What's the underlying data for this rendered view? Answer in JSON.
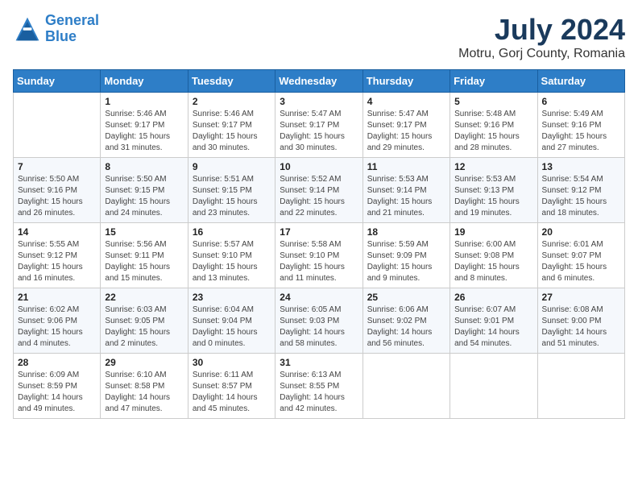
{
  "header": {
    "logo": {
      "line1": "General",
      "line2": "Blue"
    },
    "month_year": "July 2024",
    "location": "Motru, Gorj County, Romania"
  },
  "days_of_week": [
    "Sunday",
    "Monday",
    "Tuesday",
    "Wednesday",
    "Thursday",
    "Friday",
    "Saturday"
  ],
  "weeks": [
    [
      {
        "day": "",
        "info": ""
      },
      {
        "day": "1",
        "info": "Sunrise: 5:46 AM\nSunset: 9:17 PM\nDaylight: 15 hours\nand 31 minutes."
      },
      {
        "day": "2",
        "info": "Sunrise: 5:46 AM\nSunset: 9:17 PM\nDaylight: 15 hours\nand 30 minutes."
      },
      {
        "day": "3",
        "info": "Sunrise: 5:47 AM\nSunset: 9:17 PM\nDaylight: 15 hours\nand 30 minutes."
      },
      {
        "day": "4",
        "info": "Sunrise: 5:47 AM\nSunset: 9:17 PM\nDaylight: 15 hours\nand 29 minutes."
      },
      {
        "day": "5",
        "info": "Sunrise: 5:48 AM\nSunset: 9:16 PM\nDaylight: 15 hours\nand 28 minutes."
      },
      {
        "day": "6",
        "info": "Sunrise: 5:49 AM\nSunset: 9:16 PM\nDaylight: 15 hours\nand 27 minutes."
      }
    ],
    [
      {
        "day": "7",
        "info": "Sunrise: 5:50 AM\nSunset: 9:16 PM\nDaylight: 15 hours\nand 26 minutes."
      },
      {
        "day": "8",
        "info": "Sunrise: 5:50 AM\nSunset: 9:15 PM\nDaylight: 15 hours\nand 24 minutes."
      },
      {
        "day": "9",
        "info": "Sunrise: 5:51 AM\nSunset: 9:15 PM\nDaylight: 15 hours\nand 23 minutes."
      },
      {
        "day": "10",
        "info": "Sunrise: 5:52 AM\nSunset: 9:14 PM\nDaylight: 15 hours\nand 22 minutes."
      },
      {
        "day": "11",
        "info": "Sunrise: 5:53 AM\nSunset: 9:14 PM\nDaylight: 15 hours\nand 21 minutes."
      },
      {
        "day": "12",
        "info": "Sunrise: 5:53 AM\nSunset: 9:13 PM\nDaylight: 15 hours\nand 19 minutes."
      },
      {
        "day": "13",
        "info": "Sunrise: 5:54 AM\nSunset: 9:12 PM\nDaylight: 15 hours\nand 18 minutes."
      }
    ],
    [
      {
        "day": "14",
        "info": "Sunrise: 5:55 AM\nSunset: 9:12 PM\nDaylight: 15 hours\nand 16 minutes."
      },
      {
        "day": "15",
        "info": "Sunrise: 5:56 AM\nSunset: 9:11 PM\nDaylight: 15 hours\nand 15 minutes."
      },
      {
        "day": "16",
        "info": "Sunrise: 5:57 AM\nSunset: 9:10 PM\nDaylight: 15 hours\nand 13 minutes."
      },
      {
        "day": "17",
        "info": "Sunrise: 5:58 AM\nSunset: 9:10 PM\nDaylight: 15 hours\nand 11 minutes."
      },
      {
        "day": "18",
        "info": "Sunrise: 5:59 AM\nSunset: 9:09 PM\nDaylight: 15 hours\nand 9 minutes."
      },
      {
        "day": "19",
        "info": "Sunrise: 6:00 AM\nSunset: 9:08 PM\nDaylight: 15 hours\nand 8 minutes."
      },
      {
        "day": "20",
        "info": "Sunrise: 6:01 AM\nSunset: 9:07 PM\nDaylight: 15 hours\nand 6 minutes."
      }
    ],
    [
      {
        "day": "21",
        "info": "Sunrise: 6:02 AM\nSunset: 9:06 PM\nDaylight: 15 hours\nand 4 minutes."
      },
      {
        "day": "22",
        "info": "Sunrise: 6:03 AM\nSunset: 9:05 PM\nDaylight: 15 hours\nand 2 minutes."
      },
      {
        "day": "23",
        "info": "Sunrise: 6:04 AM\nSunset: 9:04 PM\nDaylight: 15 hours\nand 0 minutes."
      },
      {
        "day": "24",
        "info": "Sunrise: 6:05 AM\nSunset: 9:03 PM\nDaylight: 14 hours\nand 58 minutes."
      },
      {
        "day": "25",
        "info": "Sunrise: 6:06 AM\nSunset: 9:02 PM\nDaylight: 14 hours\nand 56 minutes."
      },
      {
        "day": "26",
        "info": "Sunrise: 6:07 AM\nSunset: 9:01 PM\nDaylight: 14 hours\nand 54 minutes."
      },
      {
        "day": "27",
        "info": "Sunrise: 6:08 AM\nSunset: 9:00 PM\nDaylight: 14 hours\nand 51 minutes."
      }
    ],
    [
      {
        "day": "28",
        "info": "Sunrise: 6:09 AM\nSunset: 8:59 PM\nDaylight: 14 hours\nand 49 minutes."
      },
      {
        "day": "29",
        "info": "Sunrise: 6:10 AM\nSunset: 8:58 PM\nDaylight: 14 hours\nand 47 minutes."
      },
      {
        "day": "30",
        "info": "Sunrise: 6:11 AM\nSunset: 8:57 PM\nDaylight: 14 hours\nand 45 minutes."
      },
      {
        "day": "31",
        "info": "Sunrise: 6:13 AM\nSunset: 8:55 PM\nDaylight: 14 hours\nand 42 minutes."
      },
      {
        "day": "",
        "info": ""
      },
      {
        "day": "",
        "info": ""
      },
      {
        "day": "",
        "info": ""
      }
    ]
  ]
}
